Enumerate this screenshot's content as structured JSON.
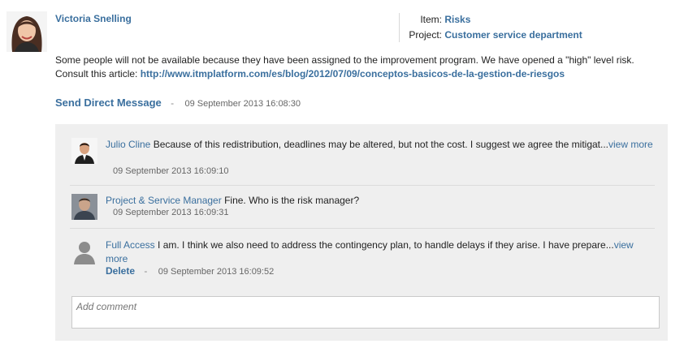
{
  "post": {
    "author": "Victoria Snelling",
    "item_label": "Item:",
    "item_value": "Risks",
    "project_label": "Project:",
    "project_value": "Customer service department",
    "body_line1": "Some people will not be available because they have been assigned to the improvement program. We have opened a \"high\" level risk.",
    "body_line2_prefix": "Consult this article: ",
    "body_link": "http://www.itmplatform.com/es/blog/2012/07/09/conceptos-basicos-de-la-gestion-de-riesgos",
    "send_dm_label": "Send Direct Message",
    "separator": "-",
    "timestamp": "09 September 2013 16:08:30"
  },
  "comments": [
    {
      "author": "Julio Cline",
      "text": " Because of this redistribution, deadlines may be altered, but not the cost. I suggest we agree the mitigat...",
      "view_more": "view more",
      "timestamp": "09 September 2013 16:09:10"
    },
    {
      "author": "Project & Service Manager",
      "text": " Fine. Who is the risk manager?",
      "timestamp": "09 September 2013 16:09:31"
    },
    {
      "author": "Full Access",
      "text": " I am. I think we also need to address the contingency plan, to handle delays if they arise. I have prepare...",
      "view_more": "view more",
      "delete_label": "Delete",
      "separator": "-",
      "timestamp": "09 September 2013 16:09:52"
    }
  ],
  "comment_input": {
    "placeholder": "Add comment"
  }
}
